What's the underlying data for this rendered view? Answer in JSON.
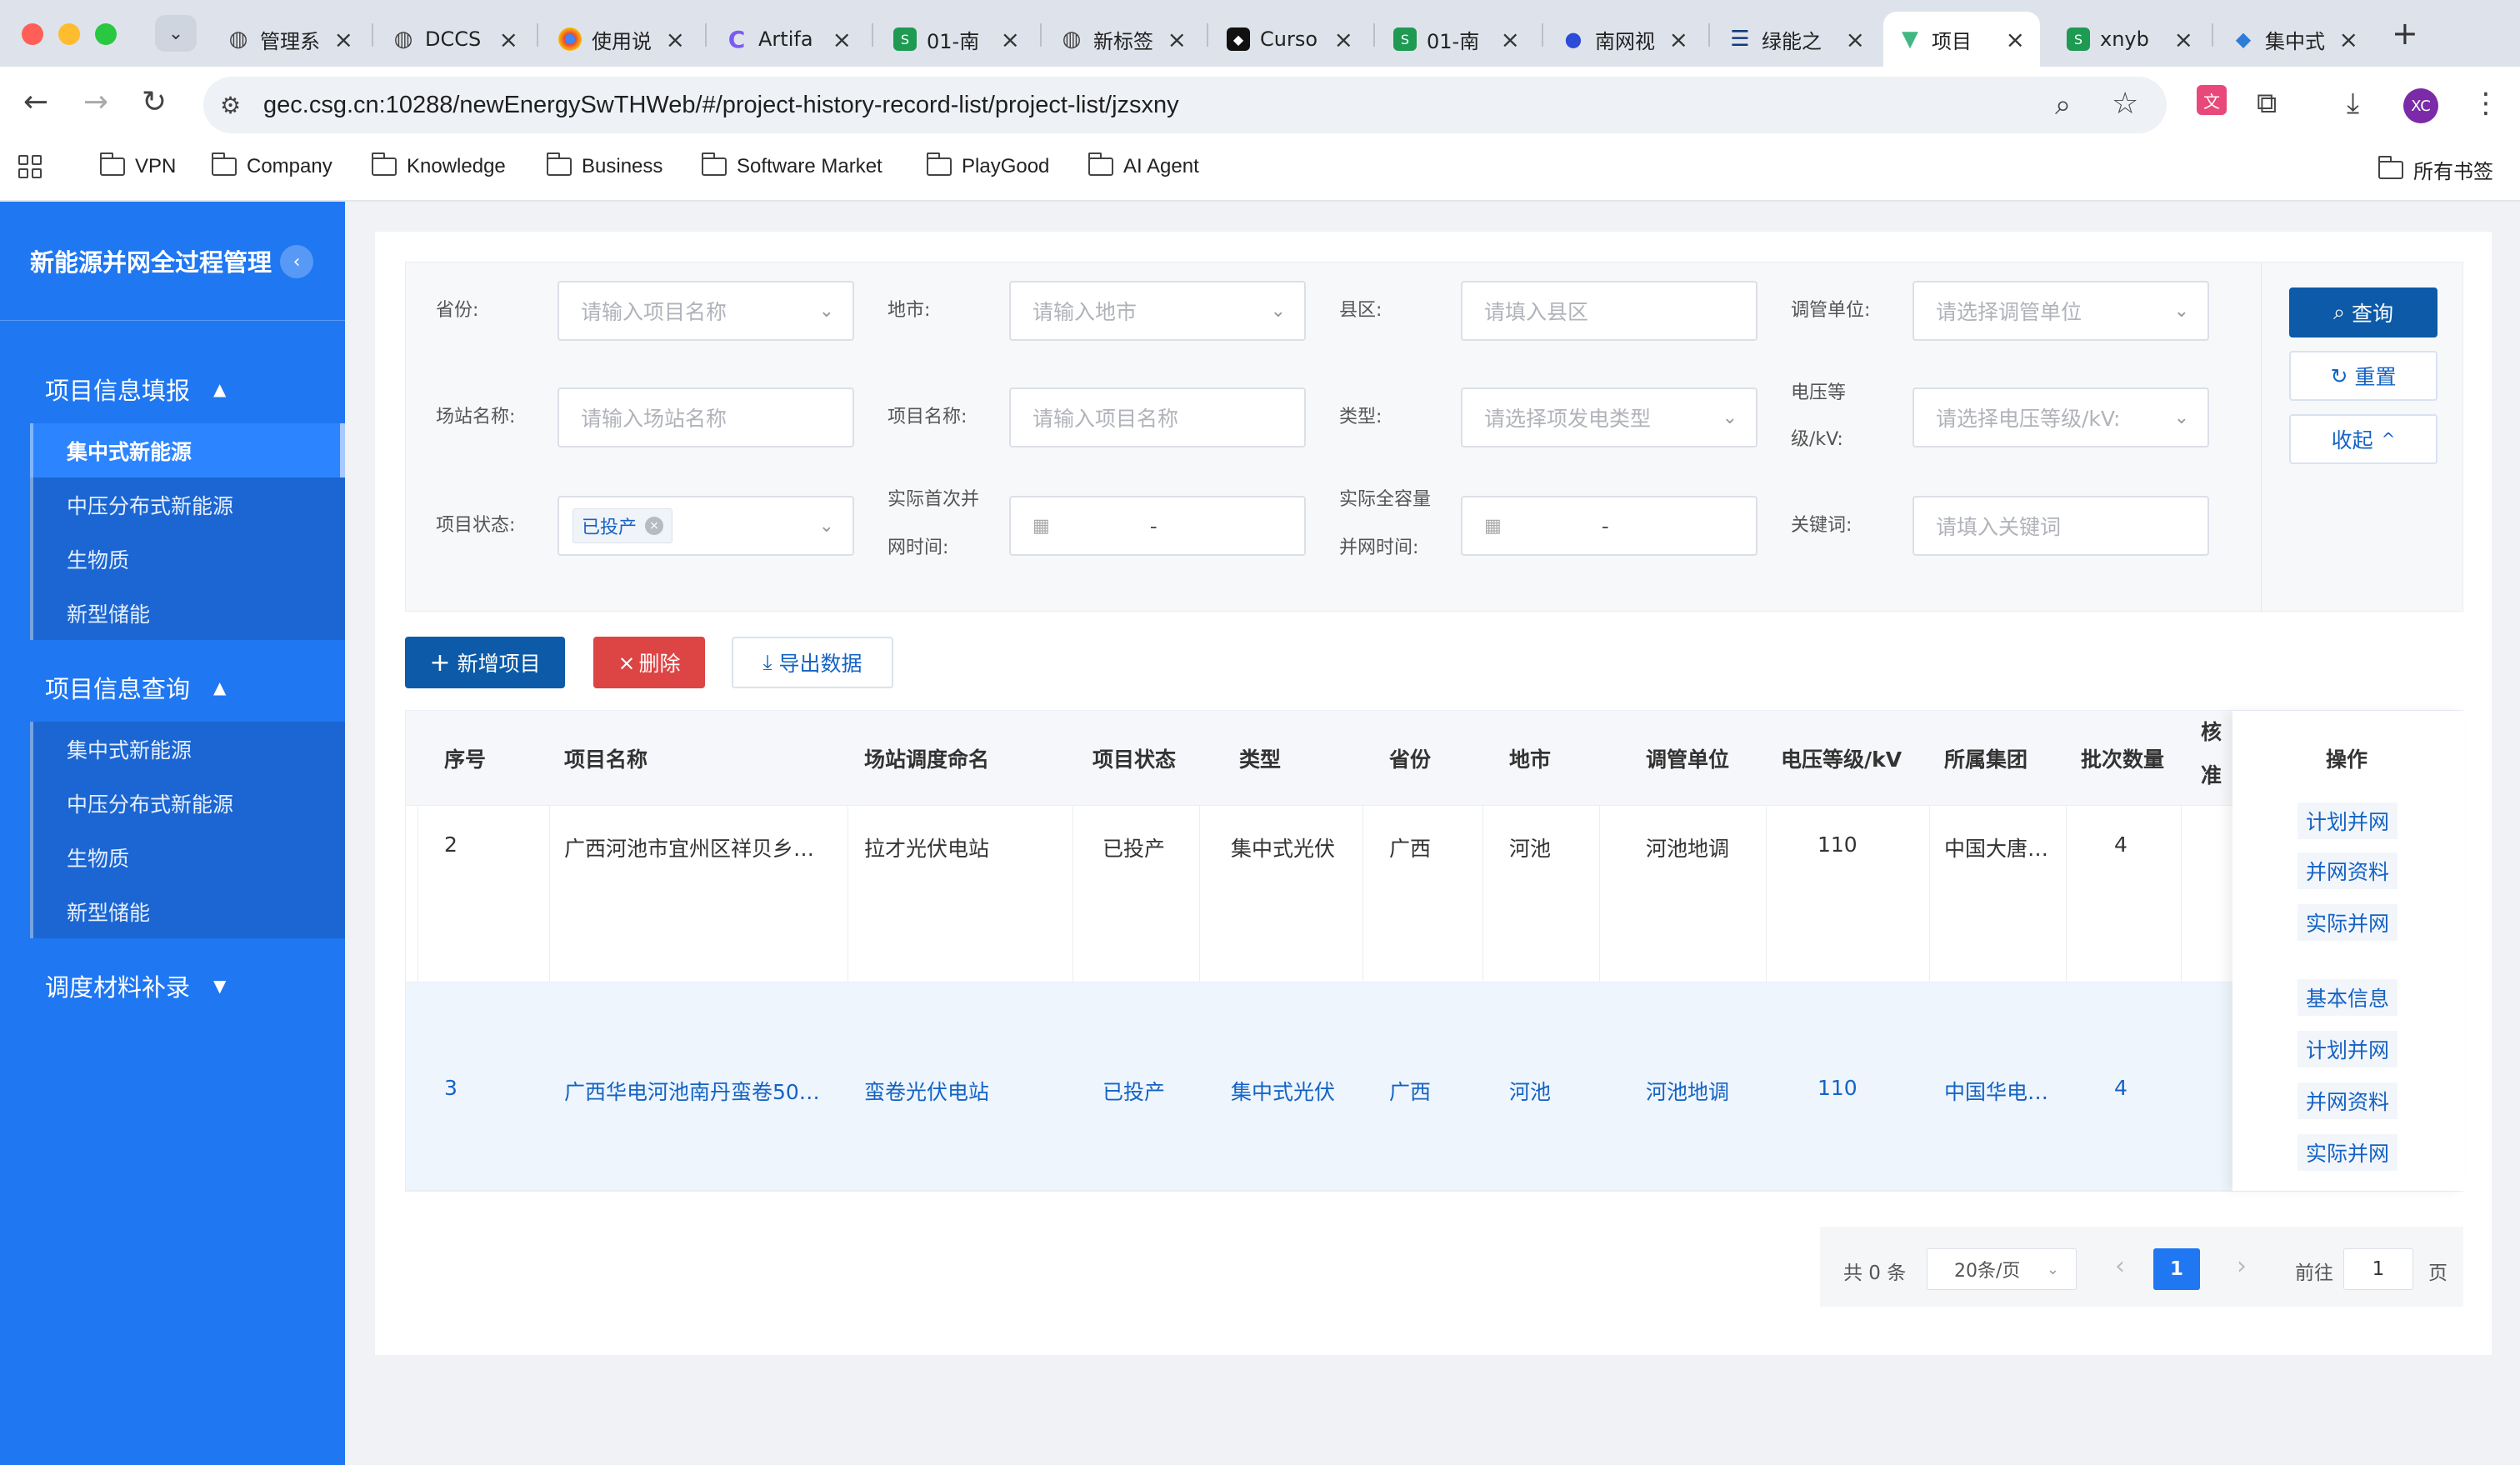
{
  "browser": {
    "tabs": [
      {
        "label": "管理系",
        "icon": "globe-icon"
      },
      {
        "label": "DCCS",
        "icon": "globe-icon"
      },
      {
        "label": "使用说",
        "icon": "chrome-icon"
      },
      {
        "label": "Artifa",
        "icon": "claude-icon"
      },
      {
        "label": "01-南",
        "icon": "sheets-icon"
      },
      {
        "label": "新标签",
        "icon": "globe-icon"
      },
      {
        "label": "Curso",
        "icon": "cursor-icon"
      },
      {
        "label": "01-南",
        "icon": "sheets-icon"
      },
      {
        "label": "南网视",
        "icon": "paw-icon"
      },
      {
        "label": "绿能之",
        "icon": "bars-icon"
      },
      {
        "label": "项目",
        "icon": "vue-icon",
        "active": true
      },
      {
        "label": "xnyb",
        "icon": "sheets-icon"
      },
      {
        "label": "集中式",
        "icon": "gem-icon"
      }
    ],
    "url": "gec.csg.cn:10288/newEnergySwTHWeb/#/project-history-record-list/project-list/jzsxny",
    "avatar": "XC",
    "bookmarks": [
      "VPN",
      "Company",
      "Knowledge",
      "Business",
      "Software Market",
      "PlayGood",
      "AI Agent"
    ],
    "all_bookmarks": "所有书签"
  },
  "sidebar": {
    "title": "新能源并网全过程管理",
    "collapse_glyph": "‹",
    "groups": [
      {
        "label": "项目信息填报",
        "arrow": "▲",
        "items": [
          "集中式新能源",
          "中压分布式新能源",
          "生物质",
          "新型储能"
        ]
      },
      {
        "label": "项目信息查询",
        "arrow": "▲",
        "items": [
          "集中式新能源",
          "中压分布式新能源",
          "生物质",
          "新型储能"
        ]
      },
      {
        "label": "调度材料补录",
        "arrow": "▼"
      }
    ]
  },
  "filters": {
    "province": {
      "label": "省份:",
      "placeholder": "请输入项目名称"
    },
    "city": {
      "label": "地市:",
      "placeholder": "请输入地市"
    },
    "county": {
      "label": "县区:",
      "placeholder": "请填入县区"
    },
    "dispatch": {
      "label": "调管单位:",
      "placeholder": "请选择调管单位"
    },
    "station": {
      "label": "场站名称:",
      "placeholder": "请输入场站名称"
    },
    "project": {
      "label": "项目名称:",
      "placeholder": "请输入项目名称"
    },
    "type": {
      "label": "类型:",
      "placeholder": "请选择项发电类型"
    },
    "voltage": {
      "label1": "电压等",
      "label2": "级/kV:",
      "placeholder": "请选择电压等级/kV:"
    },
    "status": {
      "label": "项目状态:",
      "tag": "已投产"
    },
    "first_grid": {
      "label1": "实际首次并",
      "label2": "网时间:",
      "sep": "-"
    },
    "full_grid": {
      "label1": "实际全容量",
      "label2": "并网时间:",
      "sep": "-"
    },
    "keyword": {
      "label": "关键词:",
      "placeholder": "请填入关键词"
    }
  },
  "buttons": {
    "query": "查询",
    "reset": "重置",
    "collapse": "收起",
    "add": "新增项目",
    "delete": "删除",
    "export": "导出数据"
  },
  "table": {
    "headers": [
      "序号",
      "项目名称",
      "场站调度命名",
      "项目状态",
      "类型",
      "省份",
      "地市",
      "调管单位",
      "电压等级/kV",
      "所属集团",
      "批次数量",
      "核准量",
      "操作"
    ],
    "rows": [
      {
        "no": "2",
        "name": "广西河池市宜州区祥贝乡…",
        "station": "拉才光伏电站",
        "status": "已投产",
        "type": "集中式光伏",
        "province": "广西",
        "city": "河池",
        "dispatch": "河池地调",
        "voltage": "110",
        "group": "中国大唐…",
        "batches": "4",
        "ops": [
          "计划并网",
          "并网资料",
          "实际并网"
        ]
      },
      {
        "no": "3",
        "name": "广西华电河池南丹蛮卷50…",
        "station": "蛮卷光伏电站",
        "status": "已投产",
        "type": "集中式光伏",
        "province": "广西",
        "city": "河池",
        "dispatch": "河池地调",
        "voltage": "110",
        "group": "中国华电…",
        "batches": "4",
        "ops": [
          "基本信息",
          "计划并网",
          "并网资料",
          "实际并网"
        ]
      }
    ]
  },
  "pagination": {
    "total": "共 0 条",
    "size": "20条/页",
    "prev": "‹",
    "current": "1",
    "next": "›",
    "goto": "前往",
    "goto_value": "1",
    "page_unit": "页"
  }
}
